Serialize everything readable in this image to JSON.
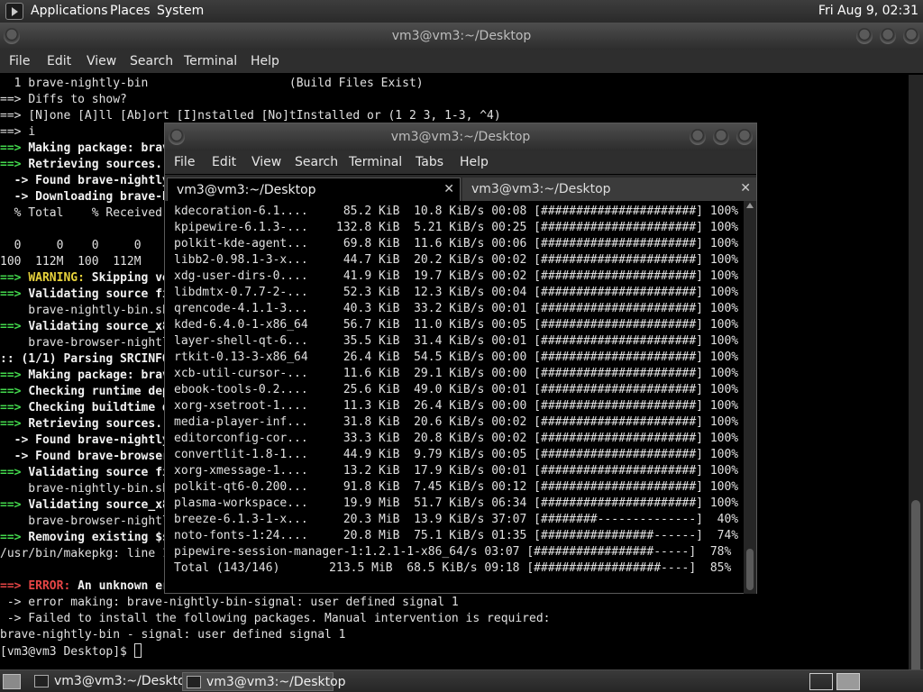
{
  "top_panel": {
    "menus": [
      "Applications",
      "Places",
      "System"
    ],
    "clock": "Fri Aug  9, 02:31"
  },
  "back_window": {
    "title": "vm3@vm3:~/Desktop",
    "menu": [
      "File",
      "Edit",
      "View",
      "Search",
      "Terminal",
      "Help"
    ],
    "lines": [
      [
        {
          "t": "  1 brave-nightly-bin                    (Build Files Exist)",
          "c": "n"
        }
      ],
      [
        {
          "t": "==> ",
          "c": "n"
        },
        {
          "t": "Diffs to show?",
          "c": "n"
        }
      ],
      [
        {
          "t": "==> ",
          "c": "n"
        },
        {
          "t": "[N]one [A]ll [Ab]ort [I]nstalled [No]tInstalled or (1 2 3, 1-3, ^4)",
          "c": "n"
        }
      ],
      [
        {
          "t": "==> ",
          "c": "n"
        },
        {
          "t": "i",
          "c": "n"
        }
      ],
      [
        {
          "t": "==> ",
          "c": "g"
        },
        {
          "t": "Making package: brave-nightly-bin",
          "c": "w"
        }
      ],
      [
        {
          "t": "==> ",
          "c": "g"
        },
        {
          "t": "Retrieving sources...",
          "c": "w"
        }
      ],
      [
        {
          "t": "  -> ",
          "c": "w"
        },
        {
          "t": "Found brave-nightly-bin",
          "c": "w"
        }
      ],
      [
        {
          "t": "  -> ",
          "c": "w"
        },
        {
          "t": "Downloading brave-browser-nightly",
          "c": "w"
        }
      ],
      [
        {
          "t": "  % Total    % Received % Xferd",
          "c": "n"
        }
      ],
      [
        {
          "t": "",
          "c": "n"
        }
      ],
      [
        {
          "t": "  0     0    0     0    0",
          "c": "n"
        }
      ],
      [
        {
          "t": "100  112M  100  112M    0",
          "c": "n"
        }
      ],
      [
        {
          "t": "==> ",
          "c": "g"
        },
        {
          "t": "WARNING: ",
          "c": "y"
        },
        {
          "t": "Skipping verification",
          "c": "w"
        }
      ],
      [
        {
          "t": "==> ",
          "c": "g"
        },
        {
          "t": "Validating source files",
          "c": "w"
        }
      ],
      [
        {
          "t": "    brave-nightly-bin.sh",
          "c": "n"
        }
      ],
      [
        {
          "t": "==> ",
          "c": "g"
        },
        {
          "t": "Validating source_x86_64",
          "c": "w"
        }
      ],
      [
        {
          "t": "    brave-browser-nightly",
          "c": "n"
        }
      ],
      [
        {
          "t": ":: (1/1) Parsing SRCINFO",
          "c": "w"
        }
      ],
      [
        {
          "t": "==> ",
          "c": "g"
        },
        {
          "t": "Making package: brave-nightly-bin",
          "c": "w"
        }
      ],
      [
        {
          "t": "==> ",
          "c": "g"
        },
        {
          "t": "Checking runtime dependencies",
          "c": "w"
        }
      ],
      [
        {
          "t": "==> ",
          "c": "g"
        },
        {
          "t": "Checking buildtime dependencies",
          "c": "w"
        }
      ],
      [
        {
          "t": "==> ",
          "c": "g"
        },
        {
          "t": "Retrieving sources...",
          "c": "w"
        }
      ],
      [
        {
          "t": "  -> ",
          "c": "w"
        },
        {
          "t": "Found brave-nightly-bin",
          "c": "w"
        }
      ],
      [
        {
          "t": "  -> ",
          "c": "w"
        },
        {
          "t": "Found brave-browser-nightly",
          "c": "w"
        }
      ],
      [
        {
          "t": "==> ",
          "c": "g"
        },
        {
          "t": "Validating source files",
          "c": "w"
        }
      ],
      [
        {
          "t": "    brave-nightly-bin.sh",
          "c": "n"
        }
      ],
      [
        {
          "t": "==> ",
          "c": "g"
        },
        {
          "t": "Validating source_x86_64",
          "c": "w"
        }
      ],
      [
        {
          "t": "    brave-browser-nightly",
          "c": "n"
        }
      ],
      [
        {
          "t": "==> ",
          "c": "g"
        },
        {
          "t": "Removing existing $srcdir",
          "c": "w"
        }
      ],
      [
        {
          "t": "/usr/bin/makepkg: line 182",
          "c": "n"
        }
      ],
      [
        {
          "t": "",
          "c": "n"
        }
      ],
      [
        {
          "t": "==> ",
          "c": "r"
        },
        {
          "t": "ERROR: ",
          "c": "r"
        },
        {
          "t": "An unknown error has occurred.",
          "c": "w"
        }
      ],
      [
        {
          "t": " -> error making: brave-nightly-bin-signal: user defined signal 1",
          "c": "n"
        }
      ],
      [
        {
          "t": " -> Failed to install the following packages. Manual intervention is required:",
          "c": "n"
        }
      ],
      [
        {
          "t": "brave-nightly-bin - signal: user defined signal 1",
          "c": "n"
        }
      ],
      [
        {
          "t": "[vm3@vm3 Desktop]$ ",
          "c": "n"
        }
      ]
    ]
  },
  "front_window": {
    "title": "vm3@vm3:~/Desktop",
    "menu": [
      "File",
      "Edit",
      "View",
      "Search",
      "Terminal",
      "Tabs",
      "Help"
    ],
    "tabs": [
      {
        "label": "vm3@vm3:~/Desktop",
        "active": true
      },
      {
        "label": "vm3@vm3:~/Desktop",
        "active": false
      }
    ],
    "lines": [
      "kdecoration-6.1....     85.2 KiB  10.8 KiB/s 00:08 [######################] 100%",
      "kpipewire-6.1.3-...    132.8 KiB  5.21 KiB/s 00:25 [######################] 100%",
      "polkit-kde-agent...     69.8 KiB  11.6 KiB/s 00:06 [######################] 100%",
      "libb2-0.98.1-3-x...     44.7 KiB  20.2 KiB/s 00:02 [######################] 100%",
      "xdg-user-dirs-0....     41.9 KiB  19.7 KiB/s 00:02 [######################] 100%",
      "libdmtx-0.7.7-2-...     52.3 KiB  12.3 KiB/s 00:04 [######################] 100%",
      "qrencode-4.1.1-3...     40.3 KiB  33.2 KiB/s 00:01 [######################] 100%",
      "kded-6.4.0-1-x86_64     56.7 KiB  11.0 KiB/s 00:05 [######################] 100%",
      "layer-shell-qt-6...     35.5 KiB  31.4 KiB/s 00:01 [######################] 100%",
      "rtkit-0.13-3-x86_64     26.4 KiB  54.5 KiB/s 00:00 [######################] 100%",
      "xcb-util-cursor-...     11.6 KiB  29.1 KiB/s 00:00 [######################] 100%",
      "ebook-tools-0.2....     25.6 KiB  49.0 KiB/s 00:01 [######################] 100%",
      "xorg-xsetroot-1....     11.3 KiB  26.4 KiB/s 00:00 [######################] 100%",
      "media-player-inf...     31.8 KiB  20.6 KiB/s 00:02 [######################] 100%",
      "editorconfig-cor...     33.3 KiB  20.8 KiB/s 00:02 [######################] 100%",
      "convertlit-1.8-1...     44.9 KiB  9.79 KiB/s 00:05 [######################] 100%",
      "xorg-xmessage-1....     13.2 KiB  17.9 KiB/s 00:01 [######################] 100%",
      "polkit-qt6-0.200...     91.8 KiB  7.45 KiB/s 00:12 [######################] 100%",
      "plasma-workspace...     19.9 MiB  51.7 KiB/s 06:34 [######################] 100%",
      "breeze-6.1.3-1-x...     20.3 MiB  13.9 KiB/s 37:07 [########--------------]  40%",
      "noto-fonts-1:24....     20.8 MiB  75.1 KiB/s 01:35 [################------]  74%",
      "pipewire-session-manager-1:1.2.1-1-x86_64/s 03:07 [#################-----]  78%",
      "Total (143/146)       213.5 MiB  68.5 KiB/s 09:18 [##################----]  85%"
    ]
  },
  "taskbar": {
    "tasks": [
      {
        "label": "vm3@vm3:~/Desktop",
        "active": false
      },
      {
        "label": "vm3@vm3:~/Desktop",
        "active": true
      }
    ],
    "workspaces": 2,
    "current_workspace": 2
  }
}
